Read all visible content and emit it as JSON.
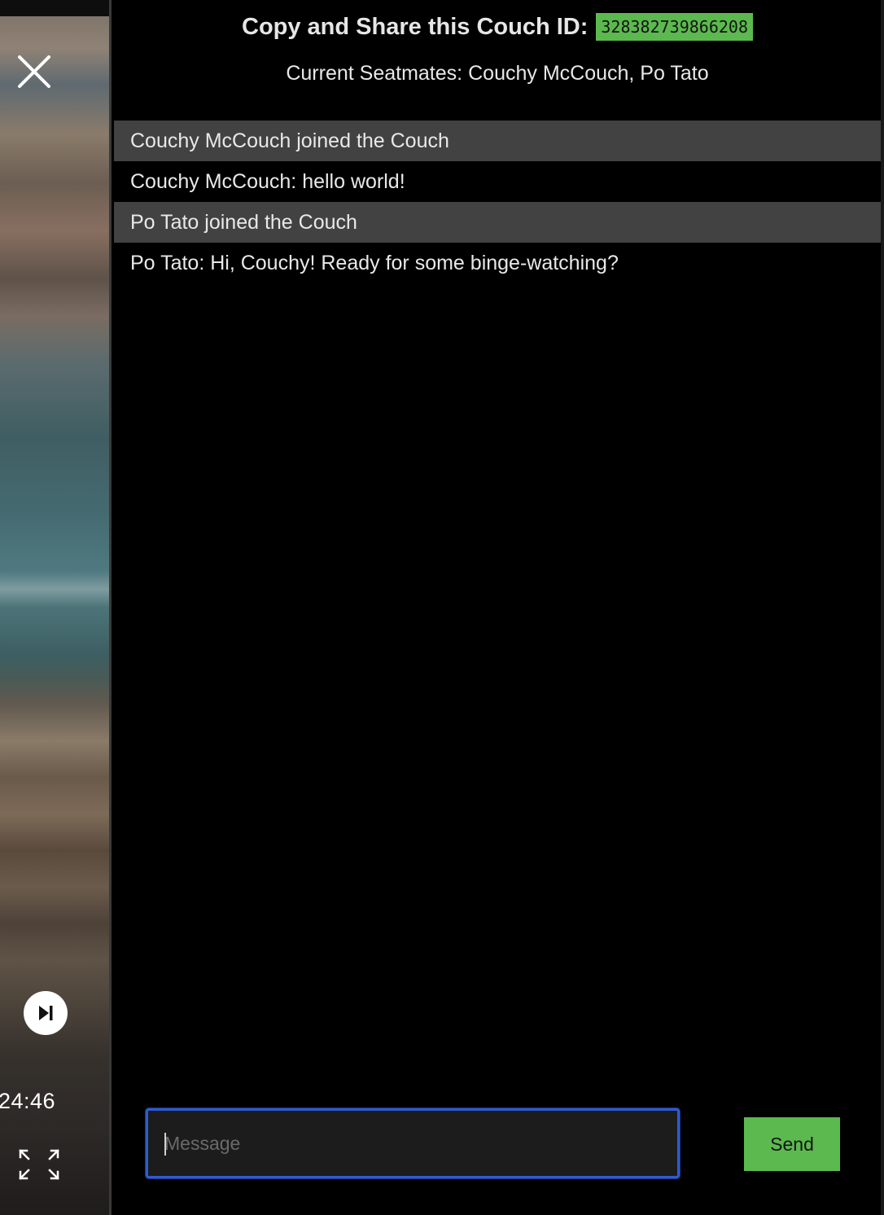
{
  "header": {
    "title": "Copy and Share this Couch ID:",
    "couch_id": "328382739866208",
    "seatmates_label": "Current Seatmates:",
    "seatmates": "Couchy McCouch, Po Tato"
  },
  "messages": [
    {
      "type": "system",
      "text": "Couchy McCouch joined the Couch"
    },
    {
      "type": "chat",
      "text": "Couchy McCouch: hello world!"
    },
    {
      "type": "system",
      "text": "Po Tato joined the Couch"
    },
    {
      "type": "chat",
      "text": "Po Tato: Hi, Couchy! Ready for some binge-watching?"
    }
  ],
  "composer": {
    "placeholder": "Message",
    "value": "",
    "send_label": "Send"
  },
  "video": {
    "time": "24:46",
    "close_icon": "close-icon",
    "skip_icon": "skip-next-icon",
    "fullscreen_icon": "fullscreen-icon"
  },
  "colors": {
    "accent_green": "#5cb94f",
    "system_row": "#424242",
    "focus_border": "#2e5ccf"
  }
}
